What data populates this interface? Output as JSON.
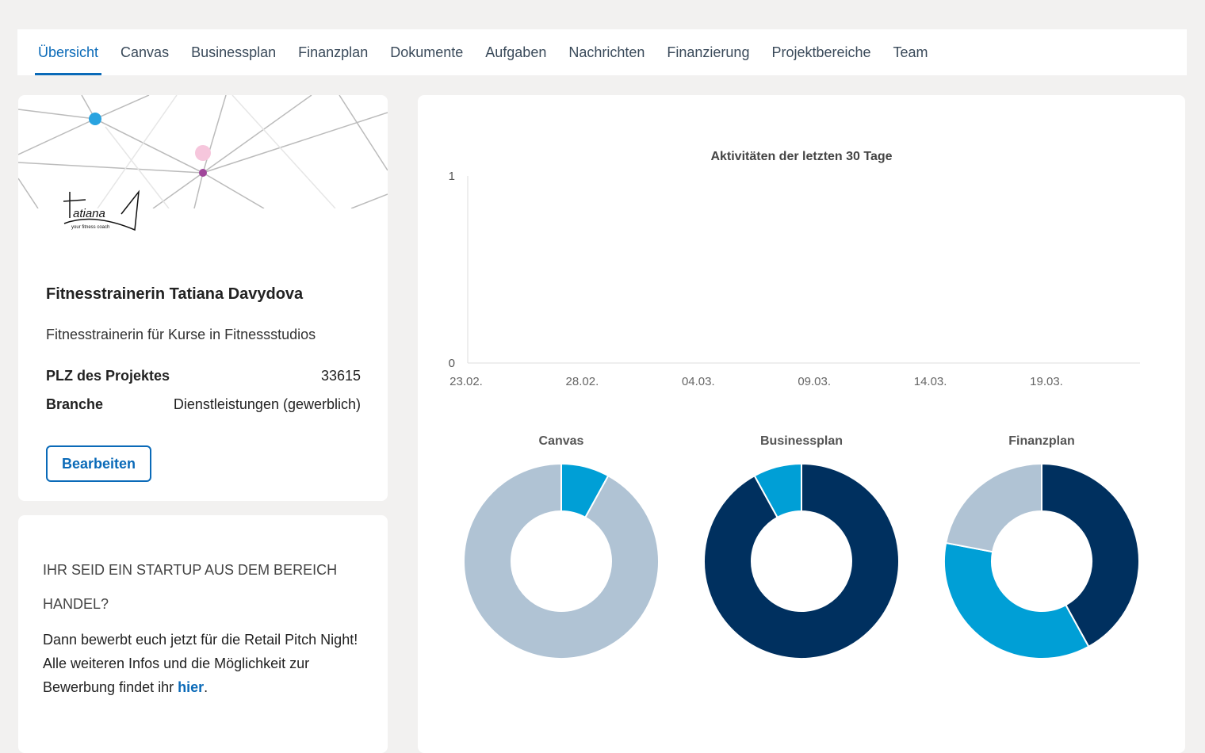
{
  "tabs": [
    {
      "label": "Übersicht",
      "active": true
    },
    {
      "label": "Canvas"
    },
    {
      "label": "Businessplan"
    },
    {
      "label": "Finanzplan"
    },
    {
      "label": "Dokumente"
    },
    {
      "label": "Aufgaben"
    },
    {
      "label": "Nachrichten"
    },
    {
      "label": "Finanzierung"
    },
    {
      "label": "Projektbereiche"
    },
    {
      "label": "Team"
    }
  ],
  "project": {
    "logo_text": "Tatiana – your fitness coach",
    "title": "Fitnesstrainerin Tatiana Davydova",
    "description": "Fitnesstrainerin für Kurse in Fitnessstudios",
    "fields": [
      {
        "label": "PLZ des Projektes",
        "value": "33615"
      },
      {
        "label": "Branche",
        "value": "Dienstleistungen (gewerblich)"
      }
    ],
    "edit_label": "Bearbeiten"
  },
  "promo": {
    "heading": "Ihr seid ein Startup aus dem Bereich Handel?",
    "text": "Dann bewerbt euch jetzt für die Retail Pitch Night! Alle weiteren Infos und die Möglichkeit zur Bewerbung findet ihr ",
    "link": "hier",
    "after": "."
  },
  "colors": {
    "navy": "#00305f",
    "cyan": "#009fd6",
    "grey": "#b0c3d4",
    "accent": "#0a6ab8"
  },
  "chart_data": [
    {
      "type": "line",
      "title": "Aktivitäten der letzten 30 Tage",
      "ylim": [
        0,
        1
      ],
      "yticks": [
        "0",
        "1"
      ],
      "xticks": [
        "23.02.",
        "28.02.",
        "04.03.",
        "09.03.",
        "14.03.",
        "19.03."
      ],
      "series": []
    },
    {
      "type": "pie",
      "donut": true,
      "title": "Canvas",
      "values": [
        8,
        92
      ],
      "colors": [
        "#009fd6",
        "#b0c3d4"
      ]
    },
    {
      "type": "pie",
      "donut": true,
      "title": "Businessplan",
      "values": [
        92,
        8
      ],
      "colors": [
        "#00305f",
        "#009fd6"
      ]
    },
    {
      "type": "pie",
      "donut": true,
      "title": "Finanzplan",
      "values": [
        42,
        36,
        22
      ],
      "colors": [
        "#00305f",
        "#009fd6",
        "#b0c3d4"
      ]
    }
  ]
}
